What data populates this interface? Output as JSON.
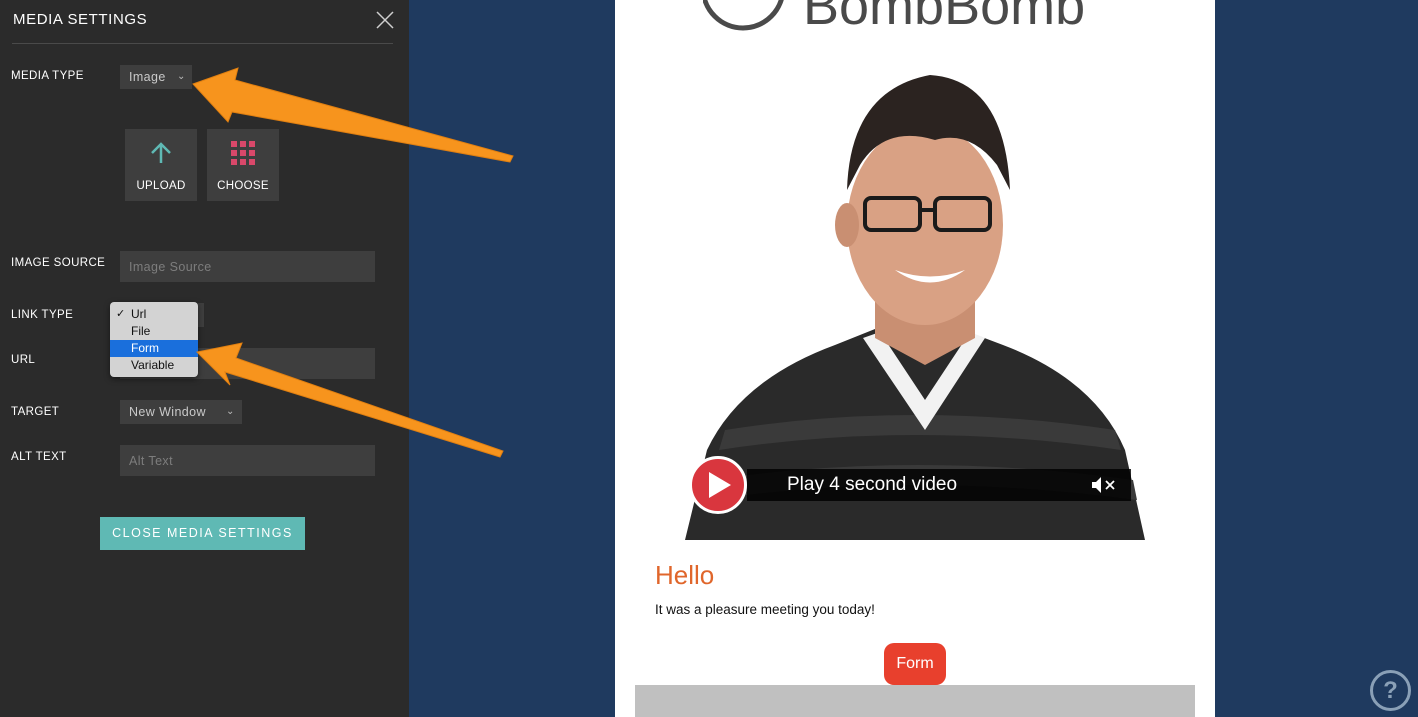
{
  "panel": {
    "title": "MEDIA SETTINGS",
    "media_type": {
      "label": "MEDIA TYPE",
      "value": "Image"
    },
    "upload_label": "UPLOAD",
    "choose_label": "CHOOSE",
    "image_source": {
      "label": "IMAGE SOURCE",
      "placeholder": "Image Source"
    },
    "link_type": {
      "label": "LINK TYPE",
      "options": [
        "Url",
        "File",
        "Form",
        "Variable"
      ],
      "checked": "Url",
      "highlighted": "Form"
    },
    "url": {
      "label": "URL"
    },
    "target": {
      "label": "TARGET",
      "value": "New Window"
    },
    "alt_text": {
      "label": "ALT TEXT",
      "placeholder": "Alt Text"
    },
    "close_button": "CLOSE MEDIA SETTINGS"
  },
  "email": {
    "logo_text": "BombBomb",
    "video_caption": "Play 4 second video",
    "greeting": "Hello",
    "message": "It was a pleasure meeting you today!",
    "form_button": "Form"
  },
  "help_label": "?",
  "colors": {
    "panel_bg": "#2b2b2b",
    "page_bg": "#1f3a5f",
    "accent_teal": "#5fb9b4",
    "choose_icon": "#d9486a",
    "upload_icon": "#5fb9b4",
    "annotation_arrow": "#f7941d",
    "greeting": "#e0662b",
    "form_button": "#e8402d",
    "play_button": "#d9363e",
    "selection_blue": "#1a6fdc"
  },
  "icons": [
    "close-icon",
    "chevron-down-icon",
    "upload-arrow-icon",
    "grid-icon",
    "checkmark-icon",
    "play-icon",
    "mute-icon",
    "help-icon",
    "annotation-arrow"
  ]
}
